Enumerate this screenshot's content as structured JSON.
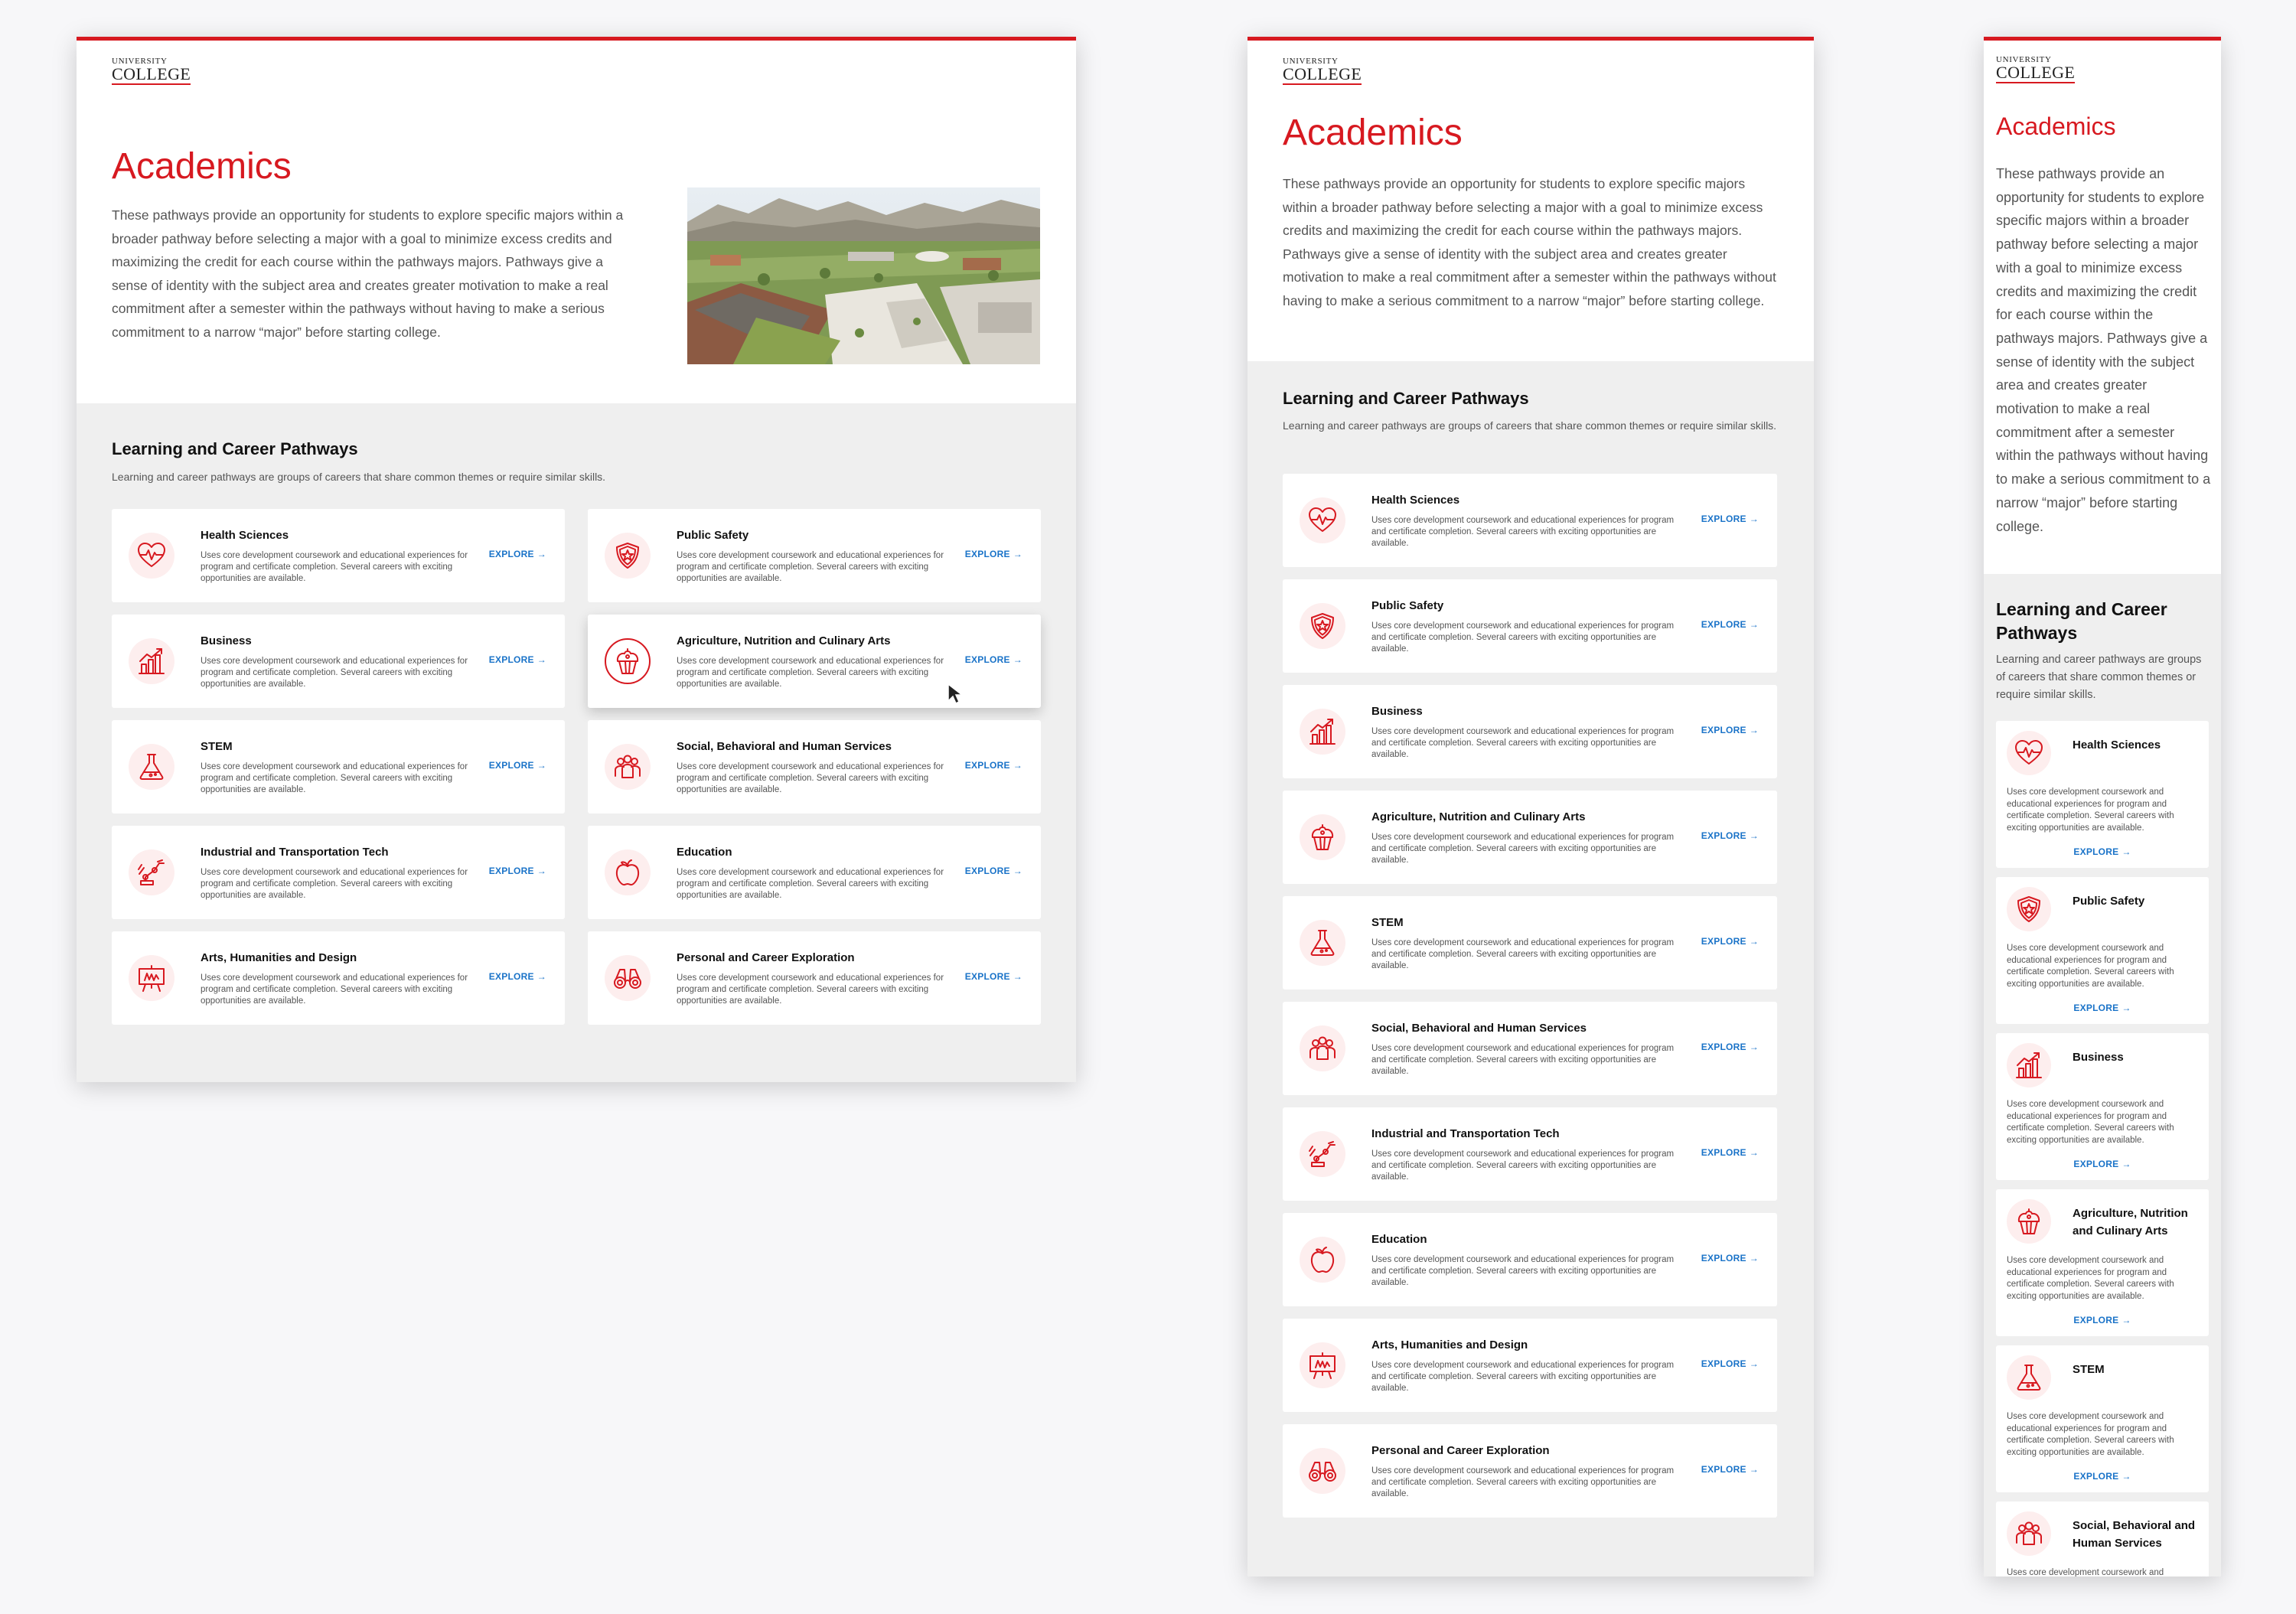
{
  "logo": {
    "line1": "UNIVERSITY",
    "line2": "COLLEGE"
  },
  "page": {
    "title": "Academics",
    "intro": "These pathways provide an opportunity for students to explore specific majors within a broader pathway before selecting a major with a goal to minimize excess credits and maximizing the credit for each course within the pathways majors. Pathways give a sense of identity with the subject area and creates greater motivation to make a real commitment after a semester within the pathways without having to make a serious commitment to a narrow “major” before starting college."
  },
  "section": {
    "title": "Learning and Career Pathways",
    "subtitle": "Learning and career pathways are groups of careers that share common themes or require similar skills."
  },
  "card_description": "Uses core development coursework and educational experiences for program and certificate completion. Several careers with exciting opportunities are available.",
  "explore_label": "EXPLORE",
  "arrow_glyph": "→",
  "colors": {
    "accent": "#d71920",
    "link": "#1a73c8",
    "section_bg": "#efefef"
  },
  "pathways": [
    {
      "title": "Health Sciences",
      "icon": "heart-pulse-icon"
    },
    {
      "title": "Public Safety",
      "icon": "shield-star-icon"
    },
    {
      "title": "Business",
      "icon": "growth-chart-icon"
    },
    {
      "title": "Agriculture, Nutrition and Culinary Arts",
      "icon": "cupcake-icon"
    },
    {
      "title": "STEM",
      "icon": "flask-icon"
    },
    {
      "title": "Social, Behavioral and Human Services",
      "icon": "people-group-icon"
    },
    {
      "title": "Industrial and Transportation Tech",
      "icon": "robotic-arm-icon"
    },
    {
      "title": "Education",
      "icon": "apple-icon"
    },
    {
      "title": "Arts, Humanities and Design",
      "icon": "easel-icon"
    },
    {
      "title": "Personal and Career Exploration",
      "icon": "binoculars-icon"
    }
  ],
  "layouts": {
    "desktop": {
      "order": [
        0,
        1,
        2,
        3,
        4,
        5,
        6,
        7,
        8,
        9
      ],
      "hovered": 3
    },
    "tablet": {
      "order": [
        0,
        1,
        2,
        3,
        4,
        5,
        6,
        7,
        8,
        9
      ]
    },
    "mobile": {
      "order": [
        0,
        1,
        2,
        3,
        4,
        5
      ]
    }
  }
}
